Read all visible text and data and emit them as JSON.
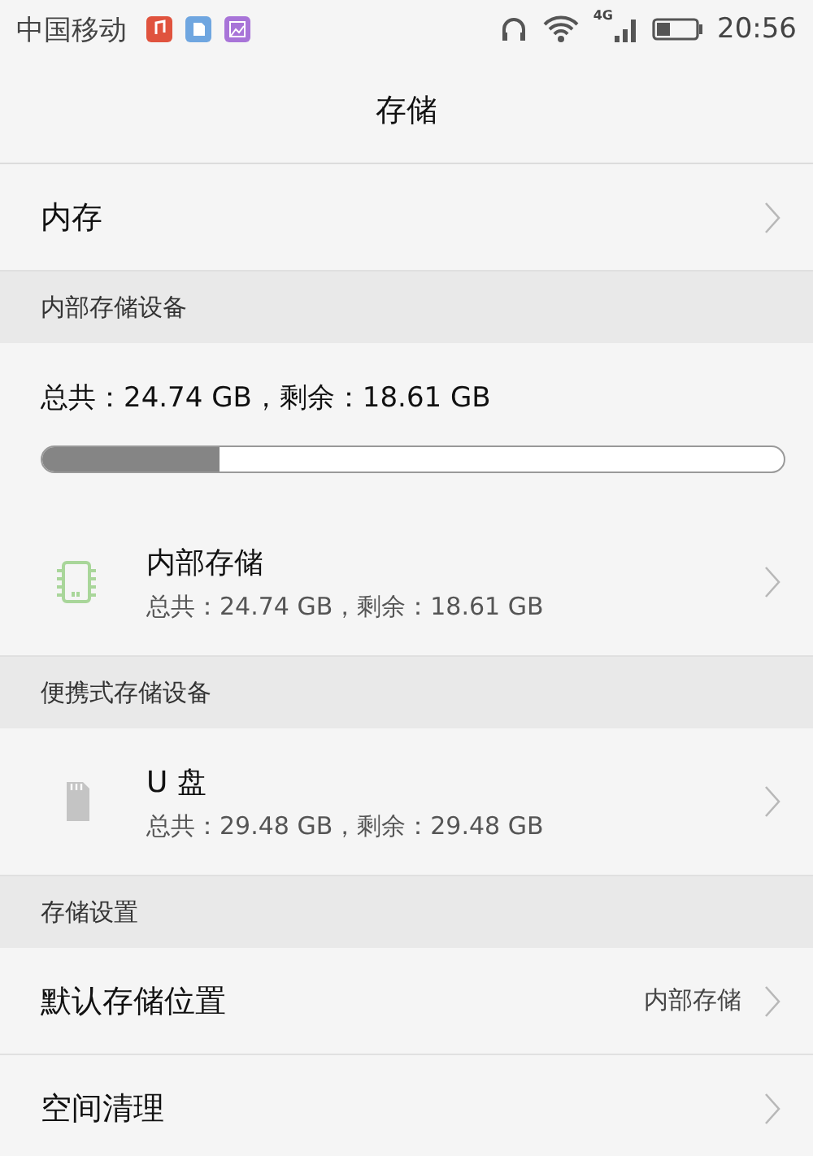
{
  "status_bar": {
    "carrier": "中国移动",
    "network": "4G",
    "time": "20:56"
  },
  "title": "存储",
  "rows": [
    {
      "kind": "link",
      "label": "内存"
    },
    {
      "kind": "header",
      "label": "内部存储设备"
    },
    {
      "kind": "summary",
      "text": "总共：24.74 GB，剩余：18.61 GB",
      "level": 0.24
    },
    {
      "kind": "internal_device",
      "name": "内部存储",
      "detail": "总共：24.74 GB，剩余：18.61 GB"
    },
    {
      "kind": "header",
      "label": "便携式存储设备"
    },
    {
      "kind": "removable_device",
      "name": "U 盘",
      "detail": "总共：29.48 GB，剩余：29.48 GB"
    },
    {
      "kind": "header",
      "label": "存储设置"
    },
    {
      "kind": "link",
      "label": "默认存储位置",
      "value": "内部存储"
    },
    {
      "kind": "link",
      "label": "空间清理"
    }
  ]
}
